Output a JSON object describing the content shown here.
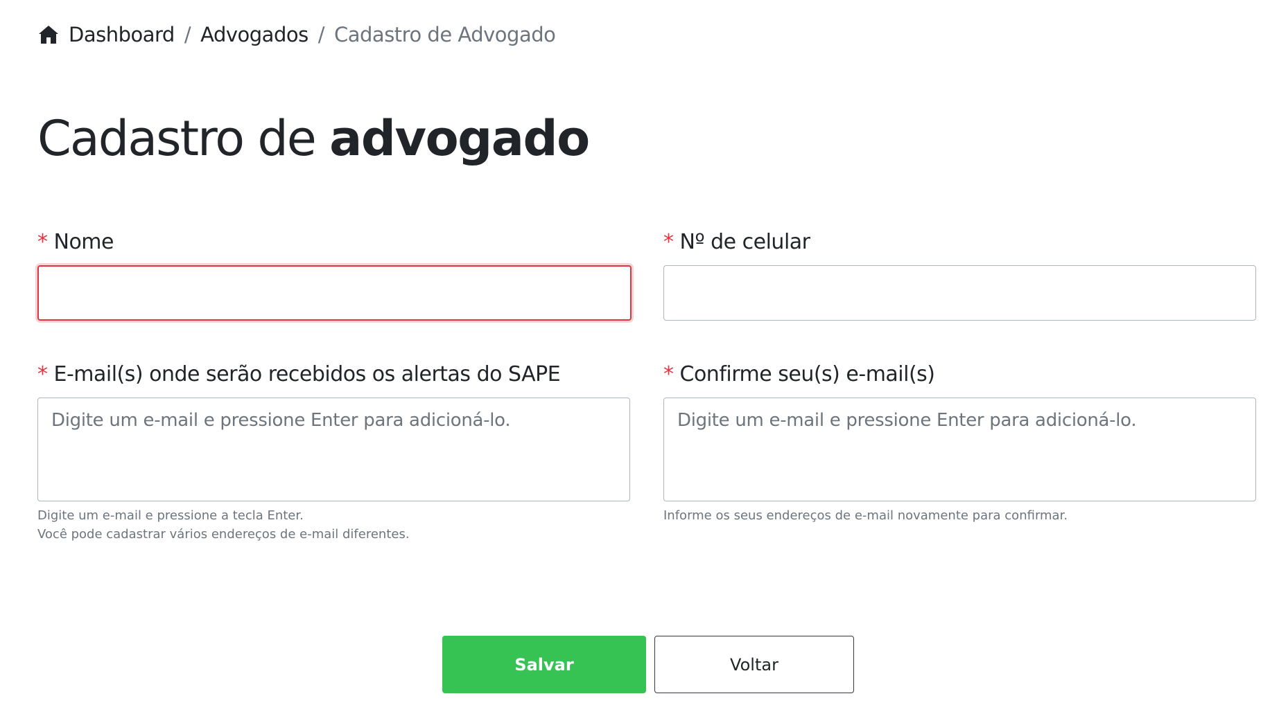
{
  "breadcrumb": {
    "icon": "home-icon",
    "items": [
      "Dashboard",
      "Advogados"
    ],
    "separator": "/",
    "current": "Cadastro de Advogado"
  },
  "page": {
    "title_light": "Cadastro de ",
    "title_bold": "advogado"
  },
  "form": {
    "required_marker": "*",
    "nome": {
      "label": "Nome",
      "value": "",
      "state": "invalid"
    },
    "celular": {
      "label": "Nº de celular",
      "value": ""
    },
    "emails": {
      "label": "E-mail(s) onde serão recebidos os alertas do SAPE",
      "placeholder": "Digite um e-mail e pressione Enter para adicioná-lo.",
      "help_line1": "Digite um e-mail e pressione a tecla Enter.",
      "help_line2": "Você pode cadastrar vários endereços de e-mail diferentes."
    },
    "confirm_emails": {
      "label": "Confirme seu(s) e-mail(s)",
      "placeholder": "Digite um e-mail e pressione Enter para adicioná-lo.",
      "help": "Informe os seus endereços de e-mail novamente para confirmar."
    }
  },
  "actions": {
    "save_label": "Salvar",
    "back_label": "Voltar"
  },
  "colors": {
    "primary_green": "#37c354",
    "required_red": "#e03540",
    "muted_text": "#6c757d",
    "text": "#212529"
  }
}
